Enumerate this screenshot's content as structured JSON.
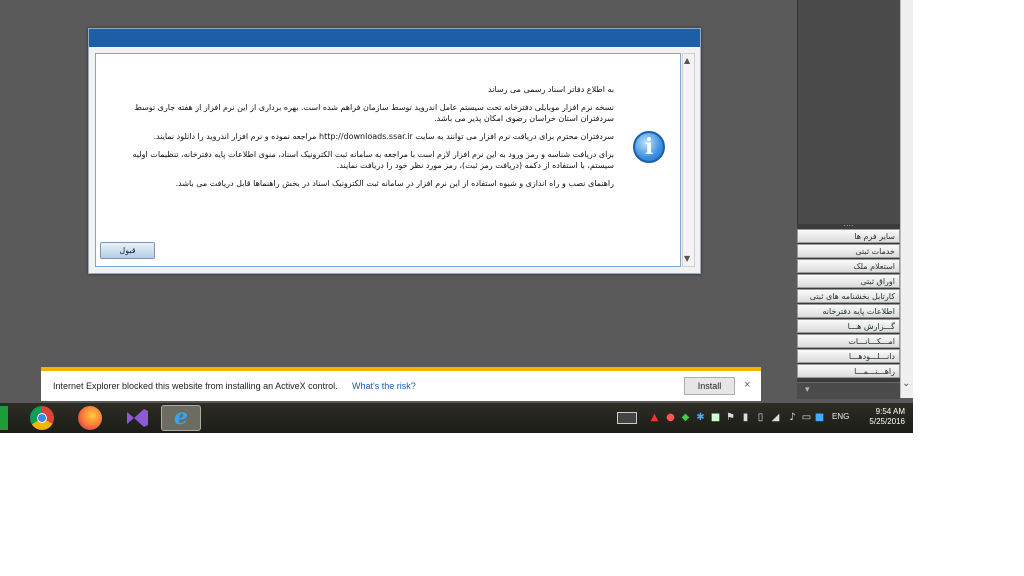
{
  "dialog": {
    "message": [
      "به اطلاع دفاتر اسناد رسمی می رساند",
      "نسخه نرم افزار موبایلی دفترخانه تحت سیستم عامل اندروید توسط سازمان فراهم شده است. بهره برداری از این نرم افزار از هفته جاری توسط سردفتران استان خراسان رضوی امکان پذیر می باشد.",
      "سردفتران محترم برای دریافت نرم افزار می توانند به سایت http://downloads.ssar.ir مراجعه نموده و نرم افزار اندروید را دانلود نمایند.",
      "برای دریافت شناسه و رمز ورود به این نرم افزار لازم است با مراجعه به سامانه ثبت الکترونیک اسناد، منوی اطلاعات پایه دفترخانه، تنظیمات اولیه سیستم، با استفاده از دکمه (دریافت رمز ثبت)، رمز مورد نظر خود را دریافت نمایند.",
      "راهنمای نصب و راه اندازی و شیوه استفاده از این نرم افزار در سامانه ثبت الکترونیک اسناد در بخش راهنماها قابل دریافت می باشد."
    ],
    "accept_label": "قبول",
    "info_icon_glyph": "i"
  },
  "side_menu": {
    "dots": "....",
    "items": [
      "سایر فرم ها",
      "خدمات ثبتی",
      "استعلام ملک",
      "اوراق ثبتی",
      "کارتابل بخشنامه های ثبتی",
      "اطلاعات پایه دفترخانه",
      "گـــزارش هـــا",
      "امـــکـــانـــات",
      "دانـــلـــودهـــا",
      "راهـــنـــمـــا"
    ]
  },
  "ie_bar": {
    "message": "Internet Explorer blocked this website from installing an ActiveX control.",
    "link": "What's the risk?",
    "install_label": "Install",
    "close_glyph": "×"
  },
  "taskbar": {
    "language": "ENG",
    "time": "9:54 AM",
    "date": "5/25/2016",
    "ie_glyph": "e"
  },
  "icons": {
    "dialog_scroll_up": "▲",
    "dialog_scroll_down": "▼",
    "side_scroll_arrow": "⌄",
    "panel_bottom": "▾"
  },
  "colors": {
    "dialog_title": "#1d5fa7",
    "ie_bar_accent": "#f0b400",
    "link": "#1a5fb4"
  }
}
